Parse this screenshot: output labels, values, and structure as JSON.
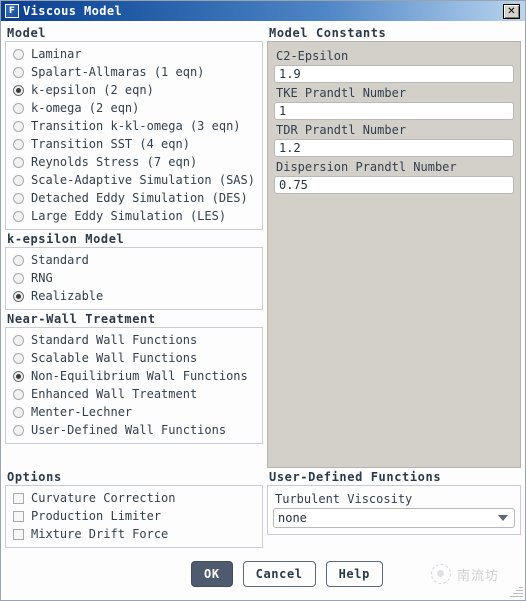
{
  "window": {
    "title": "Viscous Model",
    "app_icon": "F",
    "close_icon": "✕"
  },
  "model_group": {
    "title": "Model",
    "options": [
      {
        "label": "Laminar",
        "selected": false
      },
      {
        "label": "Spalart-Allmaras (1 eqn)",
        "selected": false
      },
      {
        "label": "k-epsilon (2 eqn)",
        "selected": true
      },
      {
        "label": "k-omega (2 eqn)",
        "selected": false
      },
      {
        "label": "Transition k-kl-omega (3 eqn)",
        "selected": false
      },
      {
        "label": "Transition SST (4 eqn)",
        "selected": false
      },
      {
        "label": "Reynolds Stress (7 eqn)",
        "selected": false
      },
      {
        "label": "Scale-Adaptive Simulation (SAS)",
        "selected": false
      },
      {
        "label": "Detached Eddy Simulation (DES)",
        "selected": false
      },
      {
        "label": "Large Eddy Simulation (LES)",
        "selected": false
      }
    ]
  },
  "kepsilon_group": {
    "title": "k-epsilon Model",
    "options": [
      {
        "label": "Standard",
        "selected": false
      },
      {
        "label": "RNG",
        "selected": false
      },
      {
        "label": "Realizable",
        "selected": true
      }
    ]
  },
  "nearwall_group": {
    "title": "Near-Wall Treatment",
    "options": [
      {
        "label": "Standard Wall Functions",
        "selected": false
      },
      {
        "label": "Scalable Wall Functions",
        "selected": false
      },
      {
        "label": "Non-Equilibrium Wall Functions",
        "selected": true
      },
      {
        "label": "Enhanced Wall Treatment",
        "selected": false
      },
      {
        "label": "Menter-Lechner",
        "selected": false
      },
      {
        "label": "User-Defined Wall Functions",
        "selected": false
      }
    ]
  },
  "options_group": {
    "title": "Options",
    "options": [
      {
        "label": "Curvature Correction",
        "checked": false
      },
      {
        "label": "Production Limiter",
        "checked": false
      },
      {
        "label": "Mixture Drift Force",
        "checked": false
      }
    ]
  },
  "constants_group": {
    "title": "Model Constants",
    "fields": [
      {
        "label": "C2-Epsilon",
        "value": "1.9"
      },
      {
        "label": "TKE Prandtl Number",
        "value": "1"
      },
      {
        "label": "TDR Prandtl Number",
        "value": "1.2"
      },
      {
        "label": "Dispersion Prandtl Number",
        "value": "0.75"
      }
    ]
  },
  "udf_group": {
    "title": "User-Defined Functions",
    "field_label": "Turbulent Viscosity",
    "selected": "none",
    "options": [
      "none"
    ]
  },
  "footer": {
    "ok_label": "OK",
    "cancel_label": "Cancel",
    "help_label": "Help",
    "watermark_text": "南流坊"
  },
  "colors": {
    "title_bar_start": "#0b3d91",
    "title_bar_end": "#b9d4ee",
    "panel_fill": "#d3d0c9",
    "group_border": "#c9ccd4",
    "text": "#33404f",
    "heading": "#2b3a4a",
    "primary_button": "#4e5b6e"
  }
}
